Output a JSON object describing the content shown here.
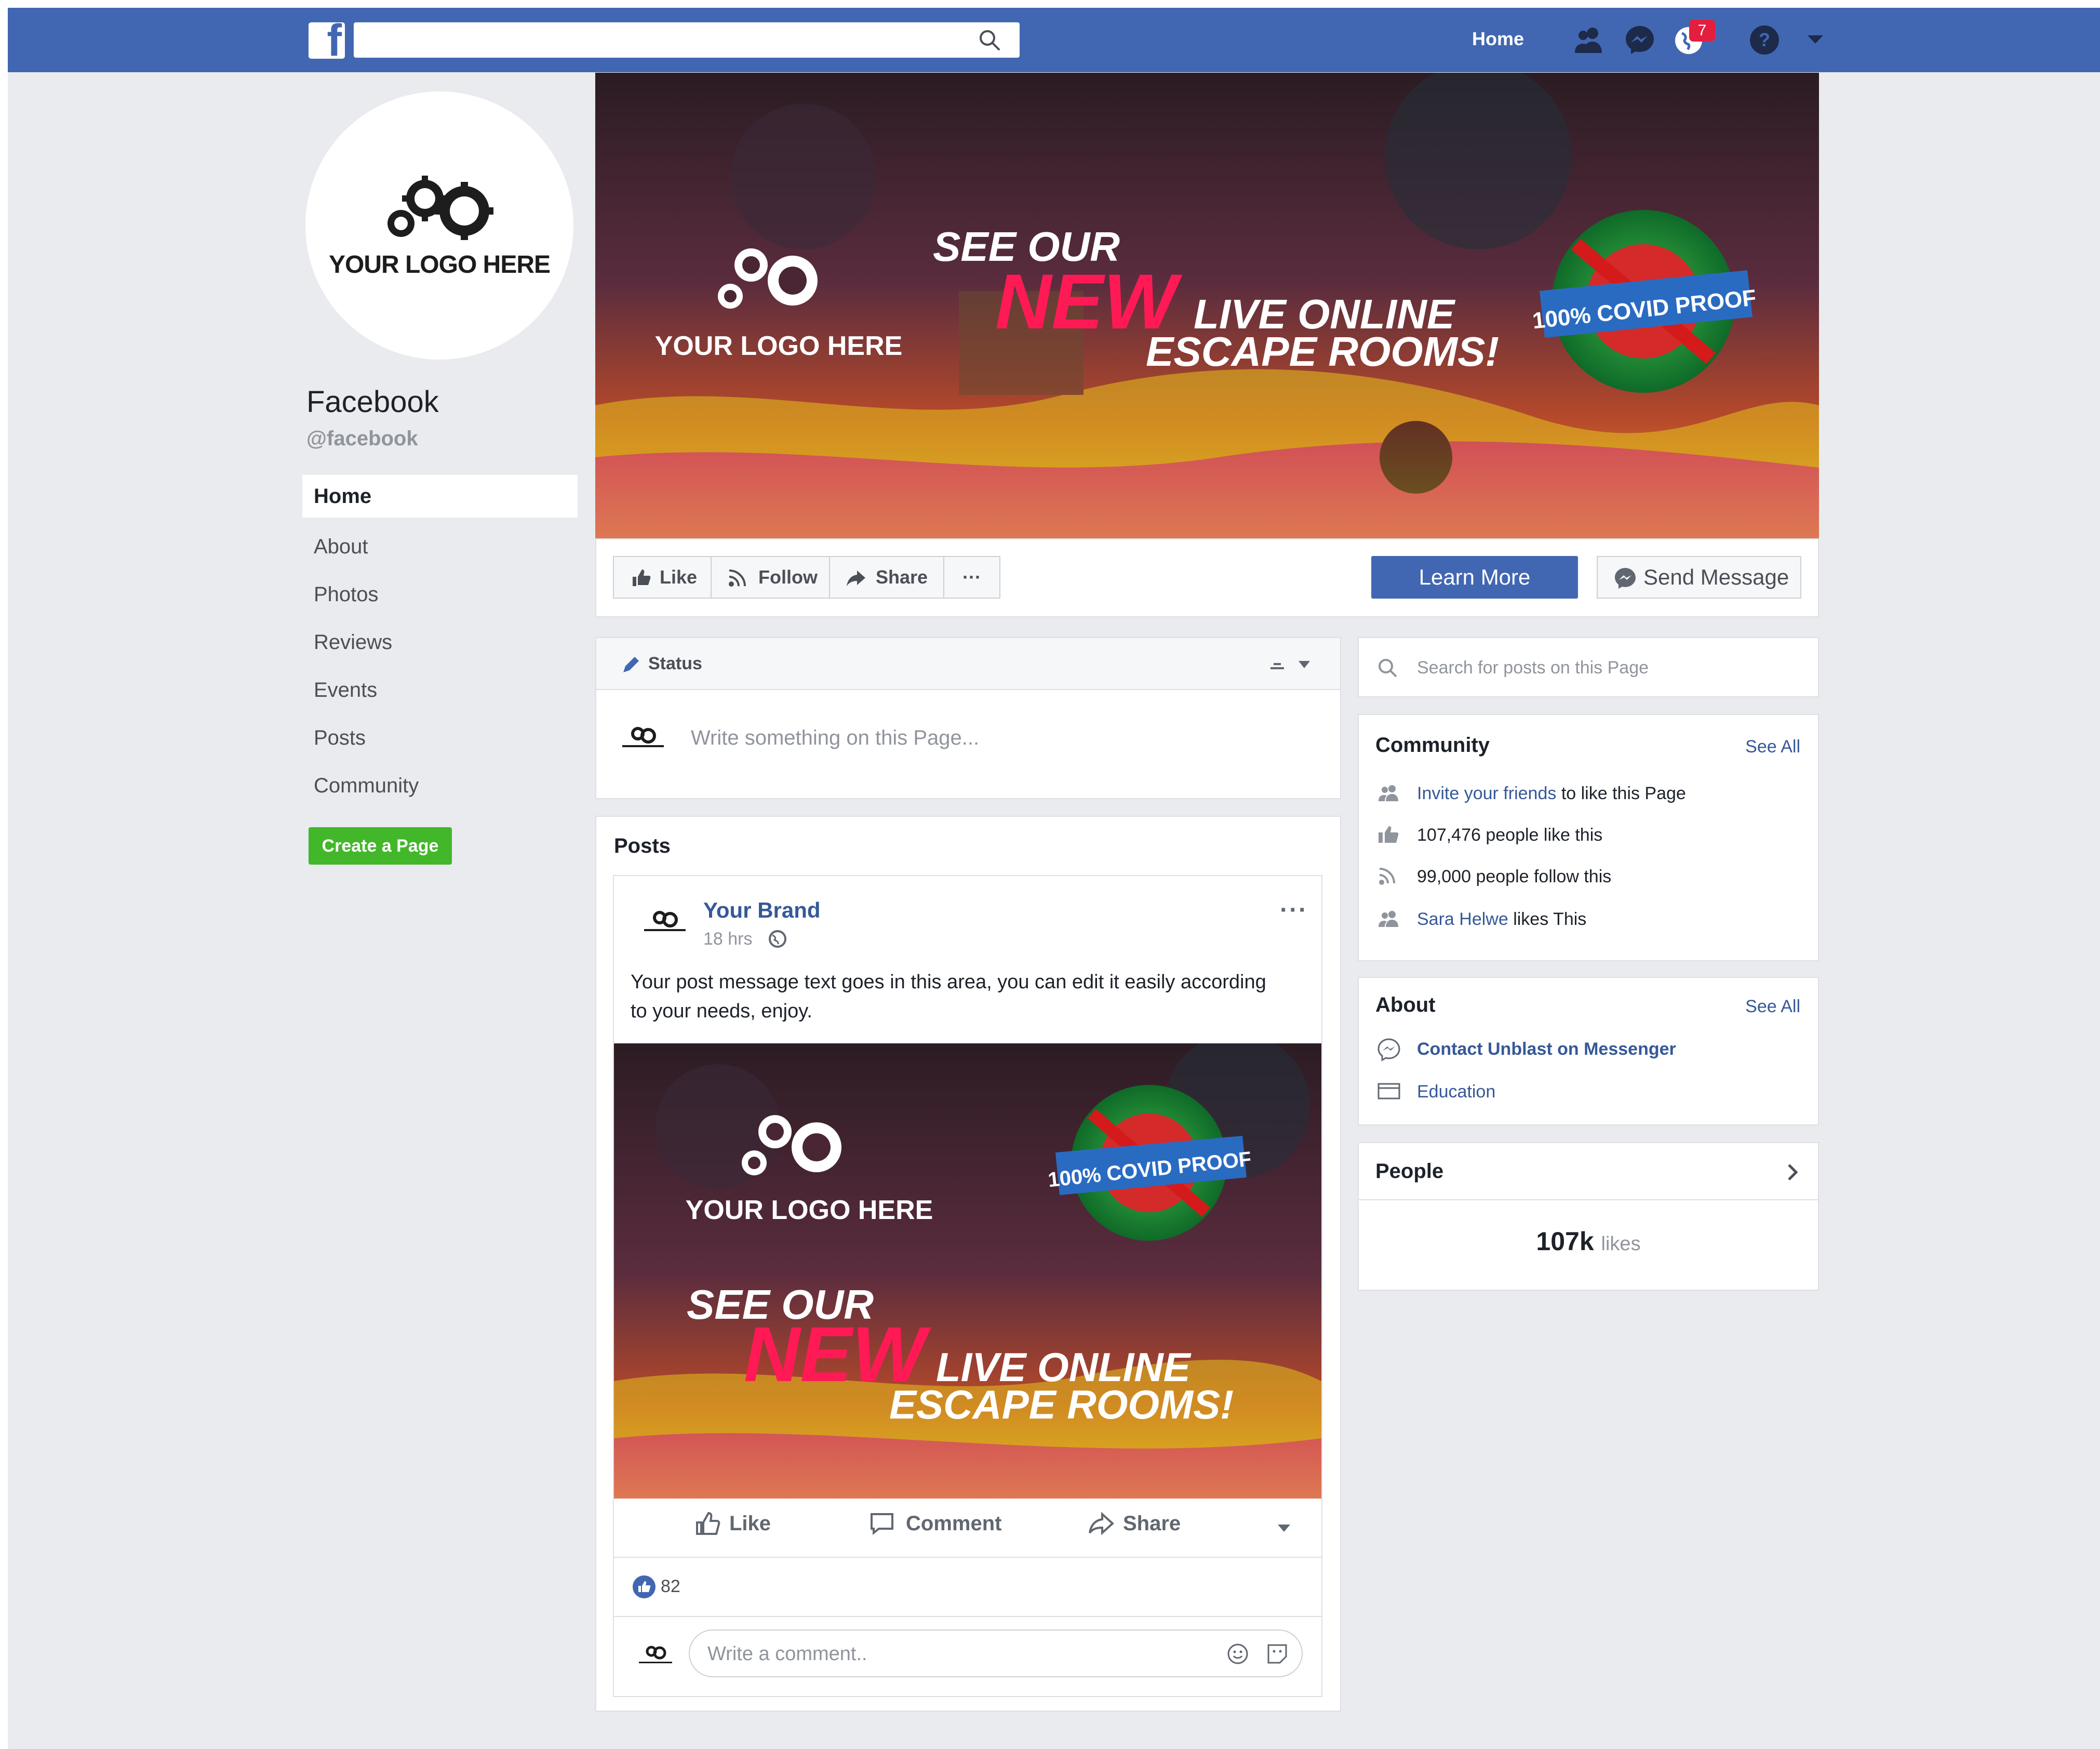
{
  "topbar": {
    "home": "Home",
    "notification_count": "7"
  },
  "profile": {
    "logo_text": "YOUR LOGO HERE",
    "name": "Facebook",
    "handle": "@facebook"
  },
  "nav": [
    "Home",
    "About",
    "Photos",
    "Reviews",
    "Events",
    "Posts",
    "Community"
  ],
  "create_page": "Create a Page",
  "cover": {
    "logo_text": "YOUR LOGO HERE",
    "line1": "SEE OUR",
    "line2": "NEW",
    "line3": "LIVE ONLINE",
    "line4": "ESCAPE ROOMS!",
    "badge": "100% COVID PROOF"
  },
  "actions": {
    "like": "Like",
    "follow": "Follow",
    "share": "Share",
    "more": "···",
    "learn_more": "Learn More",
    "send_message": "Send Message"
  },
  "status": {
    "label": "Status",
    "placeholder": "Write something on this Page..."
  },
  "posts": {
    "title": "Posts",
    "author": "Your Brand",
    "time": "18 hrs",
    "message": "Your post message text goes in this area, you can edit it easily according to your needs, enjoy.",
    "like": "Like",
    "comment": "Comment",
    "share": "Share",
    "reactions": "82",
    "comment_placeholder": "Write a comment.."
  },
  "search": {
    "placeholder": "Search for posts on this Page"
  },
  "community": {
    "title": "Community",
    "see_all": "See All",
    "invite_link": "Invite your friends",
    "invite_rest": "to like this Page",
    "likes": "107,476 people like this",
    "follows": "99,000 people follow this",
    "friend": "Sara Helwe",
    "friend_rest": "likes This"
  },
  "about": {
    "title": "About",
    "see_all": "See All",
    "messenger": "Contact Unblast on Messenger",
    "education": "Education"
  },
  "people": {
    "title": "People",
    "count": "107k",
    "unit": "likes"
  },
  "colors": {
    "brand": "#4267b2",
    "green": "#42b72a",
    "red_badge": "#e41e3f",
    "bg": "#e9ebee"
  }
}
